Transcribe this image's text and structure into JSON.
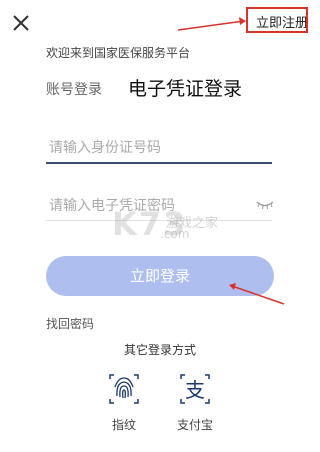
{
  "header": {
    "register_label": "立即注册"
  },
  "welcome_text": "欢迎来到国家医保服务平台",
  "tabs": [
    {
      "label": "账号登录"
    },
    {
      "label": "电子凭证登录"
    }
  ],
  "form": {
    "id_placeholder": "请输入身份证号码",
    "password_placeholder": "请输入电子凭证密码"
  },
  "watermark": {
    "main": "K73",
    "sub": "游戏之家",
    "domain": ".com"
  },
  "login_label": "立即登录",
  "forgot_label": "找回密码",
  "other_login": {
    "title": "其它登录方式",
    "methods": [
      {
        "label": "指纹",
        "icon": "fingerprint-icon"
      },
      {
        "label": "支付宝",
        "icon": "alipay-icon"
      }
    ]
  },
  "colors": {
    "accent_button": "#aebfef",
    "active_underline": "#3d4d6d",
    "annotation_red": "#d9312b",
    "icon_blue": "#1a3a6b"
  }
}
